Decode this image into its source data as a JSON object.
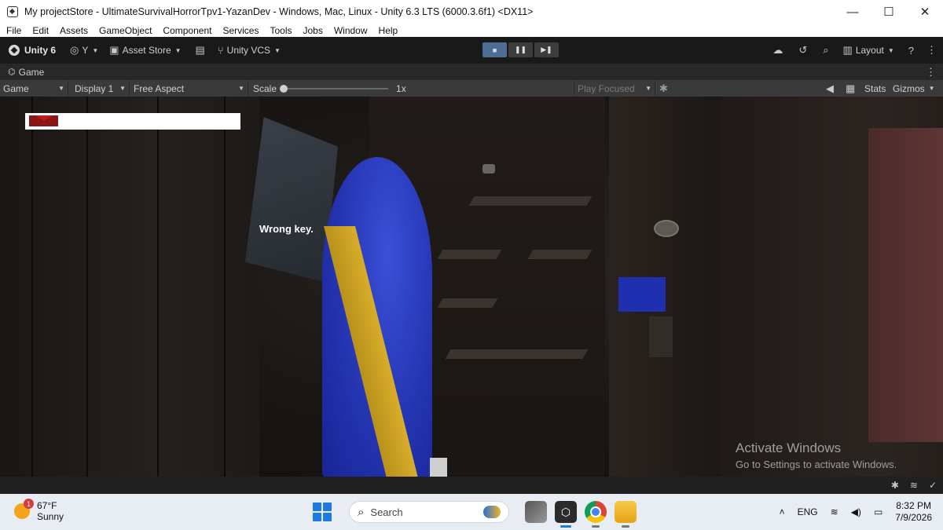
{
  "window": {
    "title": "My projectStore - UltimateSurvivalHorrorTpv1-YazanDev - Windows, Mac, Linux - Unity 6.3 LTS (6000.3.6f1) <DX11>",
    "minimize": "—",
    "maximize": "☐",
    "close": "✕"
  },
  "menu": [
    "File",
    "Edit",
    "Assets",
    "GameObject",
    "Component",
    "Services",
    "Tools",
    "Jobs",
    "Window",
    "Help"
  ],
  "toolbar": {
    "unity_label": "Unity 6",
    "account": "Y",
    "asset_store": "Asset Store",
    "vcs": "Unity VCS",
    "layout": "Layout"
  },
  "tab": {
    "label": "Game"
  },
  "gamebar": {
    "view": "Game",
    "display": "Display 1",
    "aspect": "Free Aspect",
    "scale_label": "Scale",
    "scale_value": "1x",
    "play_mode": "Play Focused",
    "stats": "Stats",
    "gizmos": "Gizmos"
  },
  "game": {
    "message": "Wrong key.",
    "health_fraction": 0.14
  },
  "watermark": {
    "line1": "Activate Windows",
    "line2": "Go to Settings to activate Windows."
  },
  "taskbar": {
    "weather_temp": "67°F",
    "weather_desc": "Sunny",
    "weather_badge": "1",
    "search_placeholder": "Search",
    "language": "ENG",
    "time": "8:32 PM",
    "date": "7/9/2026"
  },
  "colors": {
    "play_active": "#4d6d93",
    "health": "#8a1616",
    "capsule": "#2434b0",
    "stripe": "#d8ad2a"
  }
}
